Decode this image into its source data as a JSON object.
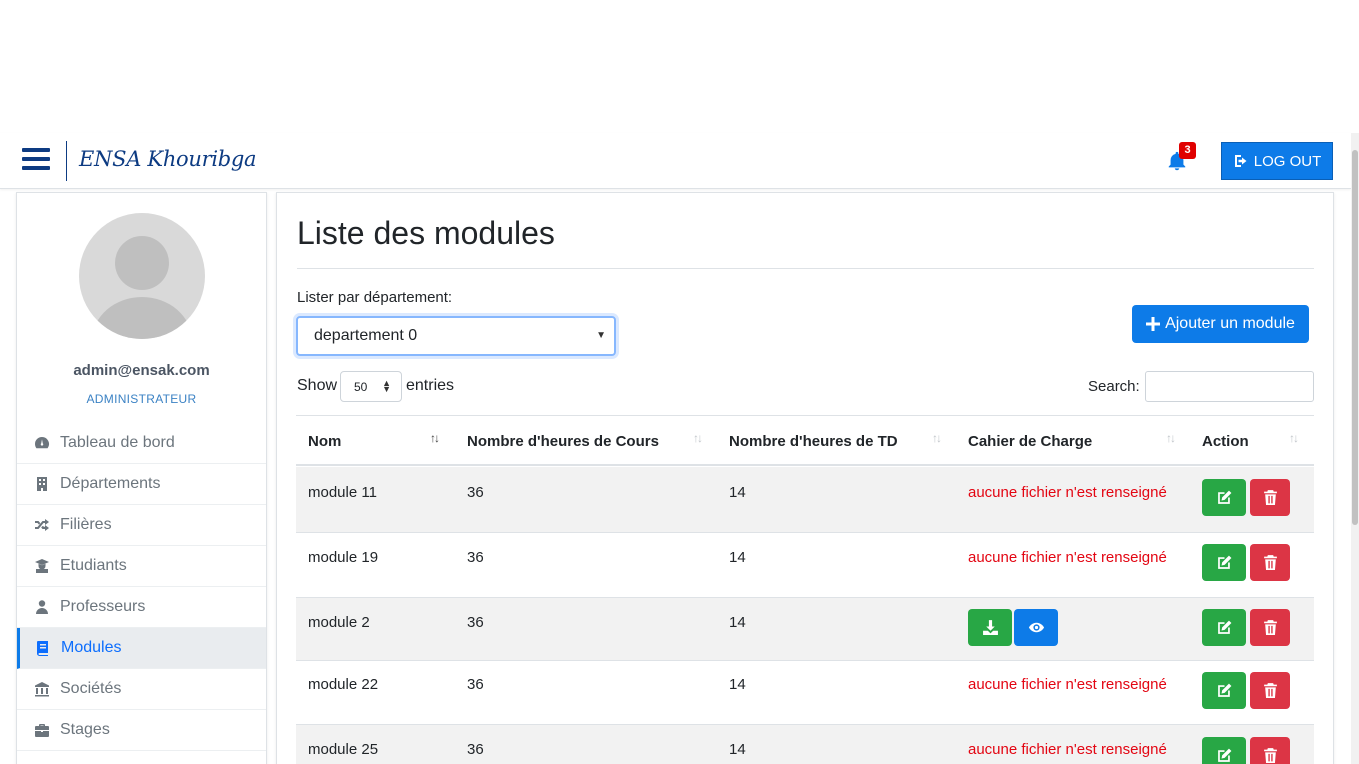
{
  "navbar": {
    "brand": "ENSA Khouribga",
    "notification_count": "3",
    "logout_label": "LOG OUT"
  },
  "sidebar": {
    "email": "admin@ensak.com",
    "role": "ADMINISTRATEUR",
    "items": [
      {
        "label": "Tableau de bord",
        "icon": "dashboard-icon"
      },
      {
        "label": "Départements",
        "icon": "building-icon"
      },
      {
        "label": "Filières",
        "icon": "shuffle-icon"
      },
      {
        "label": "Etudiants",
        "icon": "student-icon"
      },
      {
        "label": "Professeurs",
        "icon": "teacher-icon"
      },
      {
        "label": "Modules",
        "icon": "book-icon",
        "active": true
      },
      {
        "label": "Sociétés",
        "icon": "bank-icon"
      },
      {
        "label": "Stages",
        "icon": "briefcase-icon"
      }
    ]
  },
  "main": {
    "title": "Liste des modules",
    "filter_label": "Lister par département:",
    "department_selected": "departement 0",
    "add_button": "Ajouter un module",
    "show_label": "Show",
    "page_length": "50",
    "entries_label": "entries",
    "search_label": "Search:",
    "table": {
      "headers": [
        "Nom",
        "Nombre d'heures de Cours",
        "Nombre d'heures de TD",
        "Cahier de Charge",
        "Action"
      ],
      "rows": [
        {
          "nom": "module 11",
          "cours": "36",
          "td": "14",
          "cahier": "aucune fichier n'est renseigné"
        },
        {
          "nom": "module 19",
          "cours": "36",
          "td": "14",
          "cahier": "aucune fichier n'est renseigné"
        },
        {
          "nom": "module 2",
          "cours": "36",
          "td": "14",
          "cahier": ""
        },
        {
          "nom": "module 22",
          "cours": "36",
          "td": "14",
          "cahier": "aucune fichier n'est renseigné"
        },
        {
          "nom": "module 25",
          "cours": "36",
          "td": "14",
          "cahier": "aucune fichier n'est renseigné"
        }
      ]
    }
  },
  "colors": {
    "primary": "#0d7be8",
    "success": "#28a745",
    "danger": "#dc3545",
    "brand": "#0d3b82",
    "warning_text": "#e30613"
  }
}
